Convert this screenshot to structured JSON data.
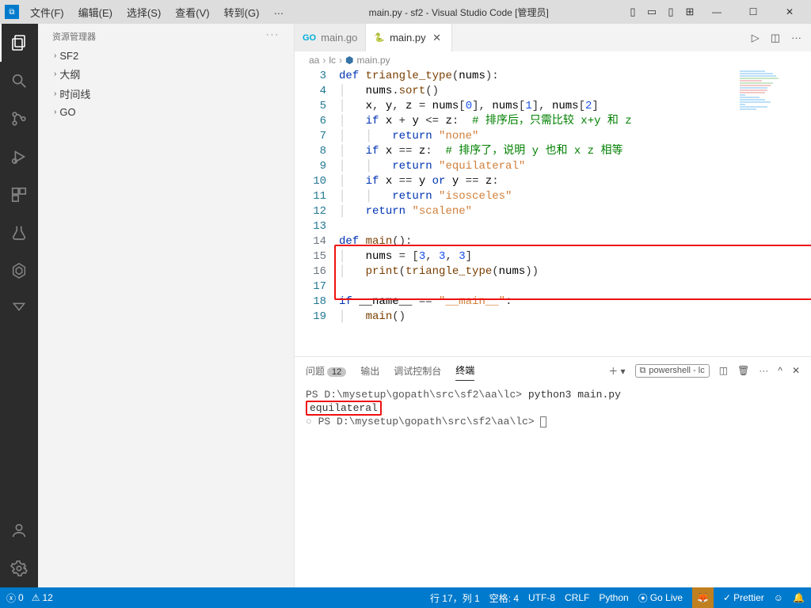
{
  "title_center": "main.py - sf2 - Visual Studio Code [管理员]",
  "menu": [
    "文件(F)",
    "编辑(E)",
    "选择(S)",
    "查看(V)",
    "转到(G)",
    "…"
  ],
  "sidebar_header": "资源管理器",
  "tree": [
    "SF2",
    "大纲",
    "时间线",
    "GO"
  ],
  "tabs": [
    {
      "icon": "GO",
      "label": "main.go"
    },
    {
      "icon": "🐍",
      "label": "main.py"
    }
  ],
  "breadcrumbs": [
    "aa",
    "lc",
    "main.py"
  ],
  "code": {
    "start": 3,
    "lines": [
      {
        "n": 3,
        "html": "<span class='kw'>def</span> <span class='fn'>triangle_type</span>(<span class='id'>nums</span>):"
      },
      {
        "n": 4,
        "html": "    <span class='id'>nums</span>.<span class='fn'>sort</span>()"
      },
      {
        "n": 5,
        "html": "    <span class='id'>x</span>, <span class='id'>y</span>, <span class='id'>z</span> = <span class='id'>nums</span>[<span class='num'>0</span>], <span class='id'>nums</span>[<span class='num'>1</span>], <span class='id'>nums</span>[<span class='num'>2</span>]"
      },
      {
        "n": 6,
        "html": "    <span class='kw'>if</span> <span class='id'>x</span> + <span class='id'>y</span> &lt;= <span class='id'>z</span>:  <span class='cmt'># 排序后，只需比较 x+y 和 z</span>"
      },
      {
        "n": 7,
        "html": "        <span class='kw'>return</span> <span class='str'>\"none\"</span>"
      },
      {
        "n": 8,
        "html": "    <span class='kw'>if</span> <span class='id'>x</span> == <span class='id'>z</span>:  <span class='cmt'># 排序了，说明 y 也和 x z 相等</span>"
      },
      {
        "n": 9,
        "html": "        <span class='kw'>return</span> <span class='str'>\"equilateral\"</span>"
      },
      {
        "n": 10,
        "html": "    <span class='kw'>if</span> <span class='id'>x</span> == <span class='id'>y</span> <span class='kw'>or</span> <span class='id'>y</span> == <span class='id'>z</span>:"
      },
      {
        "n": 11,
        "html": "        <span class='kw'>return</span> <span class='str'>\"isosceles\"</span>"
      },
      {
        "n": 12,
        "html": "    <span class='kw'>return</span> <span class='str'>\"scalene\"</span>"
      },
      {
        "n": 13,
        "html": ""
      },
      {
        "n": 14,
        "html": "<span class='kw'>def</span> <span class='fn'>main</span>():"
      },
      {
        "n": 15,
        "html": "    <span class='id'>nums</span> = [<span class='num'>3</span>, <span class='num'>3</span>, <span class='num'>3</span>]"
      },
      {
        "n": 16,
        "html": "    <span class='fn'>print</span>(<span class='fn'>triangle_type</span>(<span class='id'>nums</span>))"
      },
      {
        "n": 17,
        "html": ""
      },
      {
        "n": 18,
        "html": "<span class='kw'>if</span> <span class='id'>__name__</span> == <span class='str'>\"__main__\"</span>:"
      },
      {
        "n": 19,
        "html": "    <span class='fn'>main</span>()"
      }
    ]
  },
  "panel_tabs": {
    "problems": "问题",
    "problems_count": "12",
    "output": "输出",
    "debug": "调试控制台",
    "terminal": "终端"
  },
  "terminal_dropdown": "powershell - lc",
  "terminal": {
    "line1_prompt": "PS D:\\mysetup\\gopath\\src\\sf2\\aa\\lc> ",
    "line1_cmd": "python3 main.py",
    "line2_output": "equilateral",
    "line3_prompt": "PS D:\\mysetup\\gopath\\src\\sf2\\aa\\lc> "
  },
  "status": {
    "errors": "0",
    "warnings": "12",
    "ln_col": "行 17，列 1",
    "spaces": "空格: 4",
    "enc": "UTF-8",
    "eol": "CRLF",
    "lang": "Python",
    "golive": "Go Live",
    "prettier": "Prettier"
  }
}
